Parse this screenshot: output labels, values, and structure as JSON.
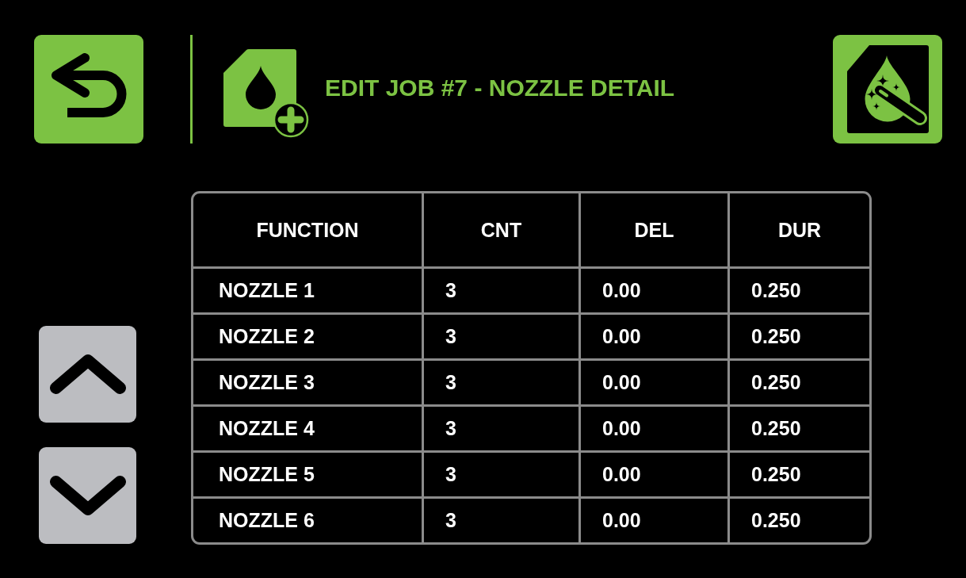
{
  "header": {
    "title": "EDIT JOB #7 - NOZZLE DETAIL"
  },
  "table": {
    "columns": [
      "FUNCTION",
      "CNT",
      "DEL",
      "DUR"
    ],
    "rows": [
      [
        "NOZZLE 1",
        "3",
        "0.00",
        "0.250"
      ],
      [
        "NOZZLE 2",
        "3",
        "0.00",
        "0.250"
      ],
      [
        "NOZZLE 3",
        "3",
        "0.00",
        "0.250"
      ],
      [
        "NOZZLE 4",
        "3",
        "0.00",
        "0.250"
      ],
      [
        "NOZZLE 5",
        "3",
        "0.00",
        "0.250"
      ],
      [
        "NOZZLE 6",
        "3",
        "0.00",
        "0.250"
      ]
    ]
  }
}
